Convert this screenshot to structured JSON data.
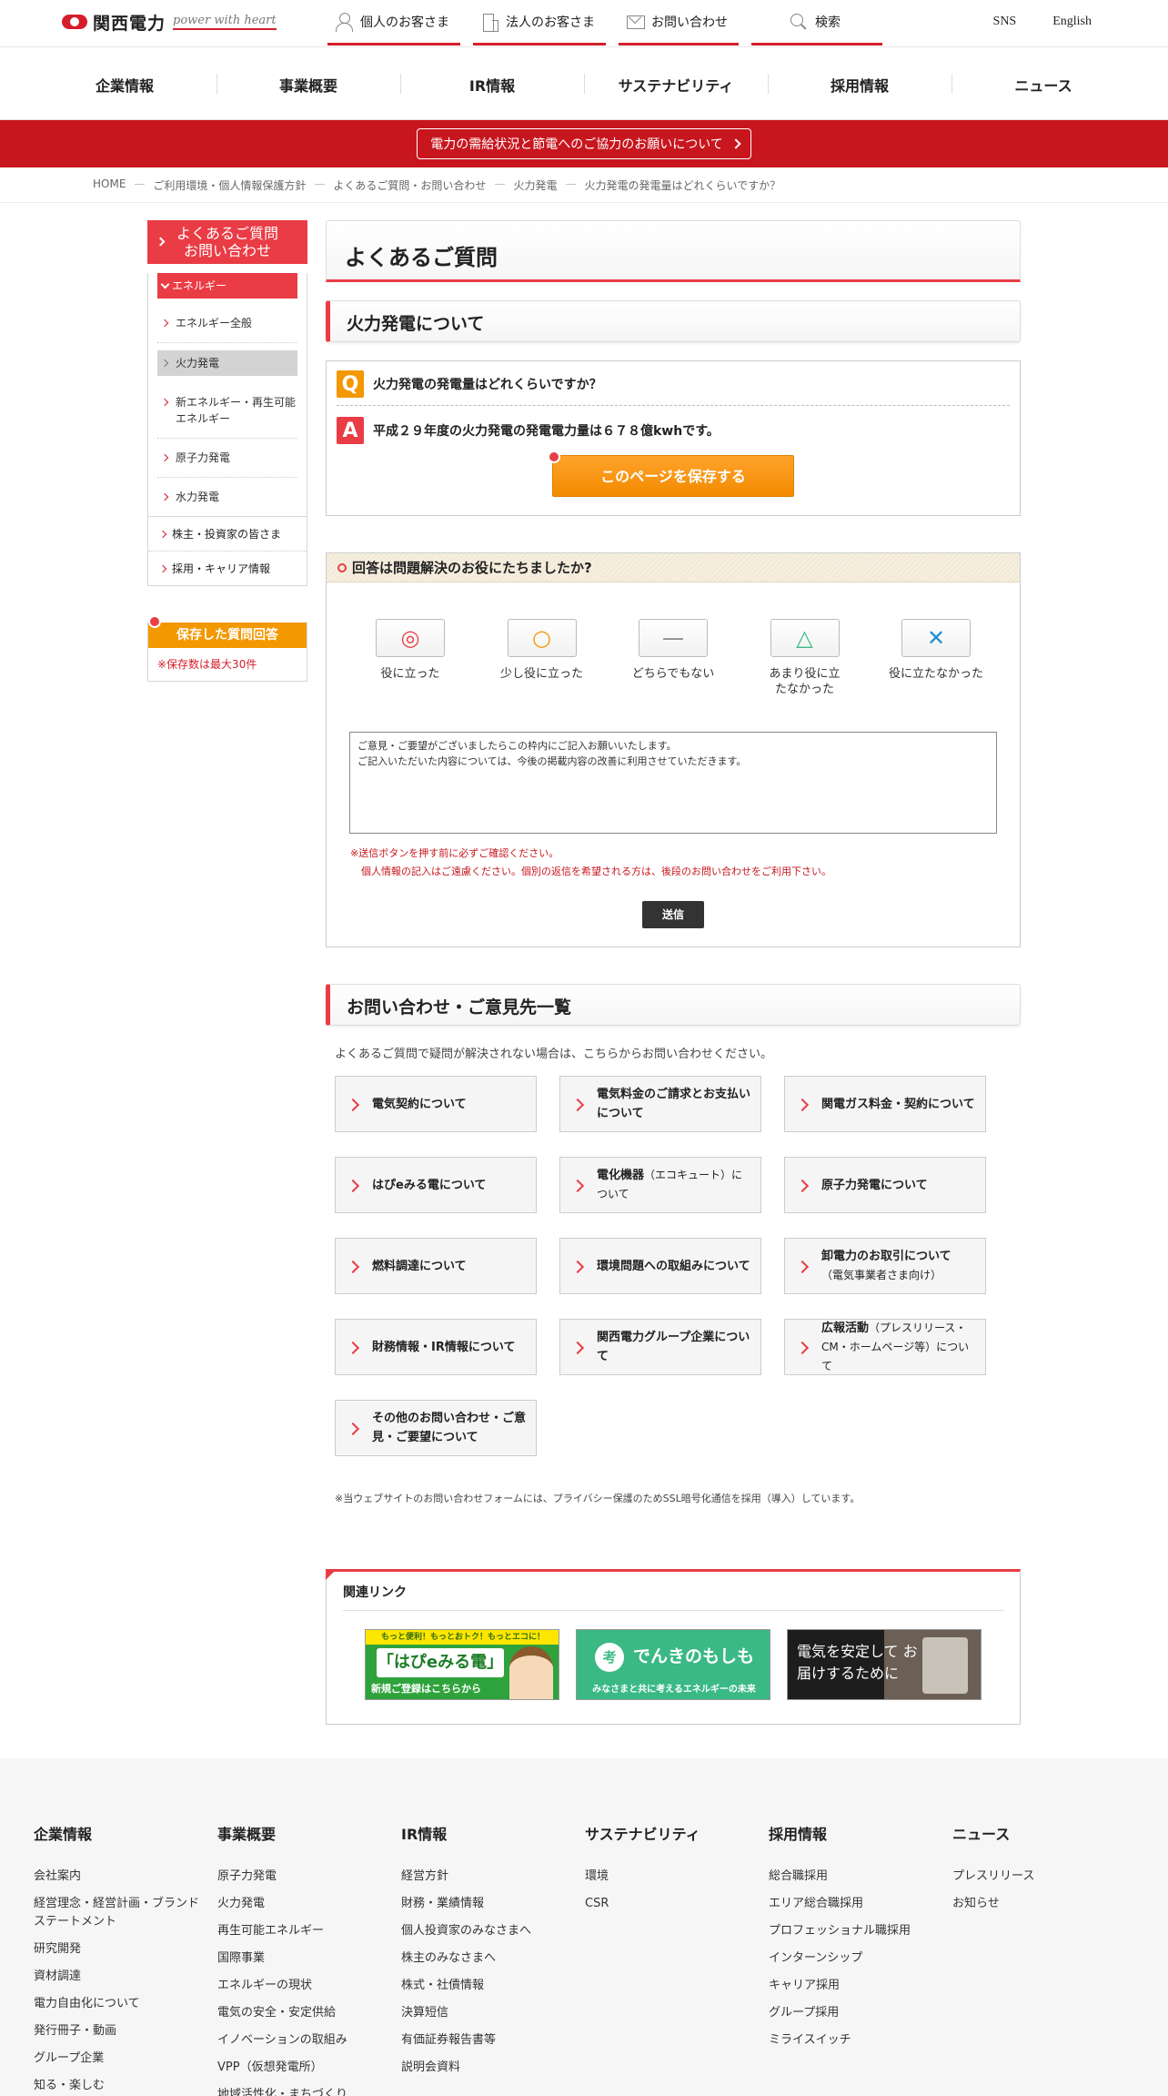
{
  "header": {
    "logo_name": "関西電力",
    "logo_tagline": "power with heart",
    "top_nav": [
      {
        "label": "個人のお客さま",
        "icon": "person-icon"
      },
      {
        "label": "法人のお客さま",
        "icon": "building-icon"
      },
      {
        "label": "お問い合わせ",
        "icon": "mail-icon"
      },
      {
        "label": "検索",
        "icon": "search-icon"
      }
    ],
    "sns_label": "SNS",
    "english_label": "English"
  },
  "global_nav": [
    "企業情報",
    "事業概要",
    "IR情報",
    "サステナビリティ",
    "採用情報",
    "ニュース"
  ],
  "notice": {
    "label": "電力の需給状況と節電へのご協力のお願いについて"
  },
  "breadcrumb": [
    "HOME",
    "ご利用環境・個人情報保護方針",
    "よくあるご質問・お問い合わせ",
    "火力発電",
    "火力発電の発電量はどれくらいですか？"
  ],
  "sidebar": {
    "title_line1": "よくあるご質問",
    "title_line2": "お問い合わせ",
    "category": "エネルギー",
    "items": [
      "エネルギー全般",
      "火力発電",
      "新エネルギー・再生可能エネルギー",
      "原子力発電",
      "水力発電"
    ],
    "active_index": 1,
    "others": [
      "株主・投資家の皆さま",
      "採用・キャリア情報"
    ],
    "saved_title": "保存した質問回答",
    "saved_note": "※保存数は最大30件"
  },
  "main": {
    "page_title": "よくあるご質問",
    "section_title": "火力発電について",
    "question_mark": "Q",
    "answer_mark": "A",
    "question": "火力発電の発電量はどれくらいですか？",
    "answer": "平成２９年度の火力発電の発電電力量は６７８億kwhです。",
    "save_button": "このページを保存する"
  },
  "survey": {
    "title": "回答は問題解決のお役にたちましたか?",
    "options": [
      {
        "symbol": "◎",
        "label": "役に立った",
        "color": "#e8434b"
      },
      {
        "symbol": "○",
        "label": "少し役に立った",
        "color": "#f39800"
      },
      {
        "symbol": "—",
        "label": "どちらでもない",
        "color": "#888888"
      },
      {
        "symbol": "△",
        "label": "あまり役に立たなかった",
        "color": "#3ab985"
      },
      {
        "symbol": "✕",
        "label": "役に立たなかった",
        "color": "#1f8fd1"
      }
    ],
    "feedback_text": "ご意見・ご要望がございましたらこの枠内にご記入お願いいたします。\nご記入いただいた内容については、今後の掲載内容の改善に利用させていただきます。",
    "warning_line1": "※送信ボタンを押す前に必ずご確認ください。",
    "warning_line2": "個人情報の記入はご遠慮ください。個別の返信を希望される方は、後段のお問い合わせをご利用下さい。",
    "submit_label": "送信"
  },
  "contacts": {
    "section_title": "お問い合わせ・ご意見先一覧",
    "intro": "よくあるご質問で疑問が解決されない場合は、こちらからお問い合わせください。",
    "items": [
      {
        "label": "電気契約について",
        "note": ""
      },
      {
        "label": "電気料金のご請求とお支払いについて",
        "note": ""
      },
      {
        "label": "関電ガス料金・契約について",
        "note": ""
      },
      {
        "label": "はぴeみる電について",
        "note": ""
      },
      {
        "label": "電化機器",
        "note": "（エコキュート）について"
      },
      {
        "label": "原子力発電について",
        "note": ""
      },
      {
        "label": "燃料調達について",
        "note": ""
      },
      {
        "label": "環境問題への取組みについて",
        "note": ""
      },
      {
        "label": "卸電力のお取引について",
        "note": "（電気事業者さま向け）"
      },
      {
        "label": "財務情報・IR情報について",
        "note": ""
      },
      {
        "label": "関西電力グループ企業について",
        "note": ""
      },
      {
        "label": "広報活動",
        "note": "（プレスリリース・CM・ホームページ等）について"
      },
      {
        "label": "その他のお問い合わせ・ご意見・ご要望について",
        "note": ""
      }
    ],
    "ssl_note": "※当ウェブサイトのお問い合わせフォームには、プライバシー保護のためSSL暗号化通信を採用（導入）しています。"
  },
  "related": {
    "title": "関連リンク",
    "banners": [
      {
        "top": "もっと便利！もっとおトク！もっとエコに！",
        "main": "「はぴeみる電」",
        "sub": "新規ご登録はこちらから"
      },
      {
        "icon": "考",
        "main": "でんきのもしも",
        "sub": "みなさまと共に考えるエネルギーの未来"
      },
      {
        "main": "電気を安定して お届けするために"
      }
    ]
  },
  "footer": {
    "columns": [
      {
        "title": "企業情報",
        "links": [
          "会社案内",
          "経営理念・経営計画・ブランドステートメント",
          "研究開発",
          "資材調達",
          "電力自由化について",
          "発行冊子・動画",
          "グループ企業",
          "知る・楽しむ"
        ]
      },
      {
        "title": "事業概要",
        "links": [
          "原子力発電",
          "火力発電",
          "再生可能エネルギー",
          "国際事業",
          "エネルギーの現状",
          "電気の安全・安定供給",
          "イノベーションの取組み",
          "VPP（仮想発電所）",
          "地域活性化・まちづくり"
        ]
      },
      {
        "title": "IR情報",
        "links": [
          "経営方針",
          "財務・業績情報",
          "個人投資家のみなさまへ",
          "株主のみなさまへ",
          "株式・社債情報",
          "決算短信",
          "有価証券報告書等",
          "説明会資料"
        ]
      },
      {
        "title": "サステナビリティ",
        "links": [
          "環境",
          "CSR"
        ]
      },
      {
        "title": "採用情報",
        "links": [
          "総合職採用",
          "エリア総合職採用",
          "プロフェッショナル職採用",
          "インターンシップ",
          "キャリア採用",
          "グループ採用",
          "ミライスイッチ"
        ]
      },
      {
        "title": "ニュース",
        "links": [
          "プレスリリース",
          "お知らせ"
        ]
      }
    ]
  }
}
